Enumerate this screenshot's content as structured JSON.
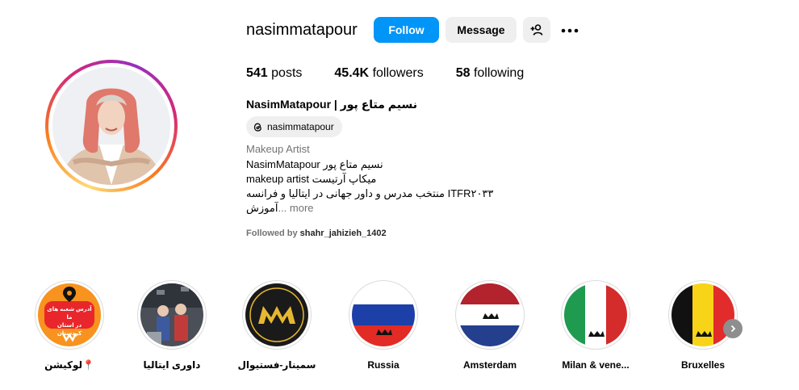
{
  "profile": {
    "username": "nasimmatapour",
    "full_name": "NasimMatapour | نسیم متاع پور",
    "threads_handle": "nasimmatapour",
    "category": "Makeup Artist",
    "bio_lines": [
      "NasimMatapour نسیم متاع پور",
      "makeup artist میکاپ آرتیست",
      "منتخب مدرس و داور جهانی در ایتالیا و فرانسه ITFR۲۰۳۳",
      "آموزش"
    ],
    "bio_more": "... more",
    "followed_by_prefix": "Followed by",
    "followed_by_user": "shahr_jahizieh_1402"
  },
  "actions": {
    "follow_label": "Follow",
    "message_label": "Message",
    "add_user_icon": "add-user-icon",
    "more_icon": "more-options-icon"
  },
  "stats": {
    "posts_count": "541",
    "posts_label": "posts",
    "followers_count": "45.4K",
    "followers_label": "followers",
    "following_count": "58",
    "following_label": "following"
  },
  "highlights": [
    {
      "label": "لوکیشن📍",
      "cover": "location"
    },
    {
      "label": "داوری ایتالیا",
      "cover": "photo"
    },
    {
      "label": "سمینار-فستیوال",
      "cover": "nm-logo"
    },
    {
      "label": "Russia",
      "cover": "flag-russia"
    },
    {
      "label": "Amsterdam",
      "cover": "flag-netherlands"
    },
    {
      "label": "Milan & vene...",
      "cover": "flag-italy"
    },
    {
      "label": "Bruxelles",
      "cover": "flag-belgium"
    }
  ],
  "location_cover": {
    "line1": "آدرس شعبه های ما",
    "line2": "در استان کردستان"
  },
  "colors": {
    "follow_blue": "#0095f6",
    "button_gray": "#efefef",
    "muted_text": "#737373",
    "location_orange": "#f7931e",
    "location_red": "#e8262b",
    "logo_gold": "#e8b732"
  }
}
